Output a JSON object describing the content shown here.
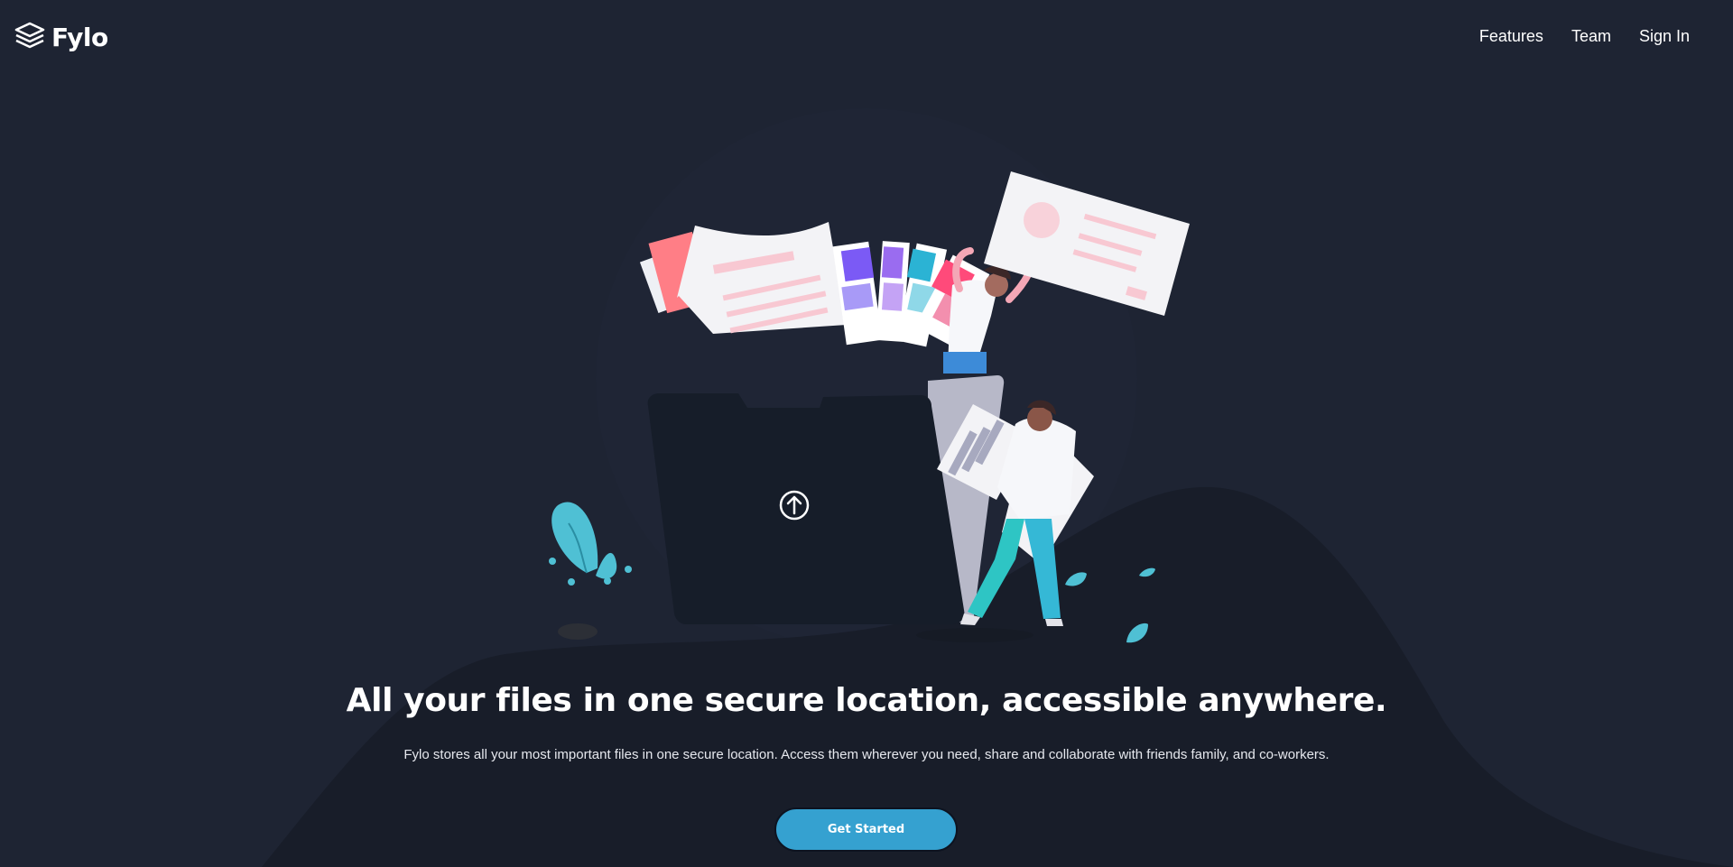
{
  "header": {
    "logo_text": "Fylo",
    "nav": [
      {
        "label": "Features"
      },
      {
        "label": "Team"
      },
      {
        "label": "Sign In"
      }
    ]
  },
  "hero": {
    "title": "All your files in one secure location, accessible anywhere.",
    "subtitle": "Fylo stores all your most important files in one secure location. Access them wherever you need, share and collaborate with friends family, and co-workers.",
    "cta_label": "Get Started"
  },
  "colors": {
    "background": "#1e2433",
    "background_curve": "#181d29",
    "accent": "#35a1d0",
    "text": "#ffffff"
  },
  "icons": {
    "logo": "stacked-layers-icon",
    "upload": "upload-arrow-icon"
  }
}
